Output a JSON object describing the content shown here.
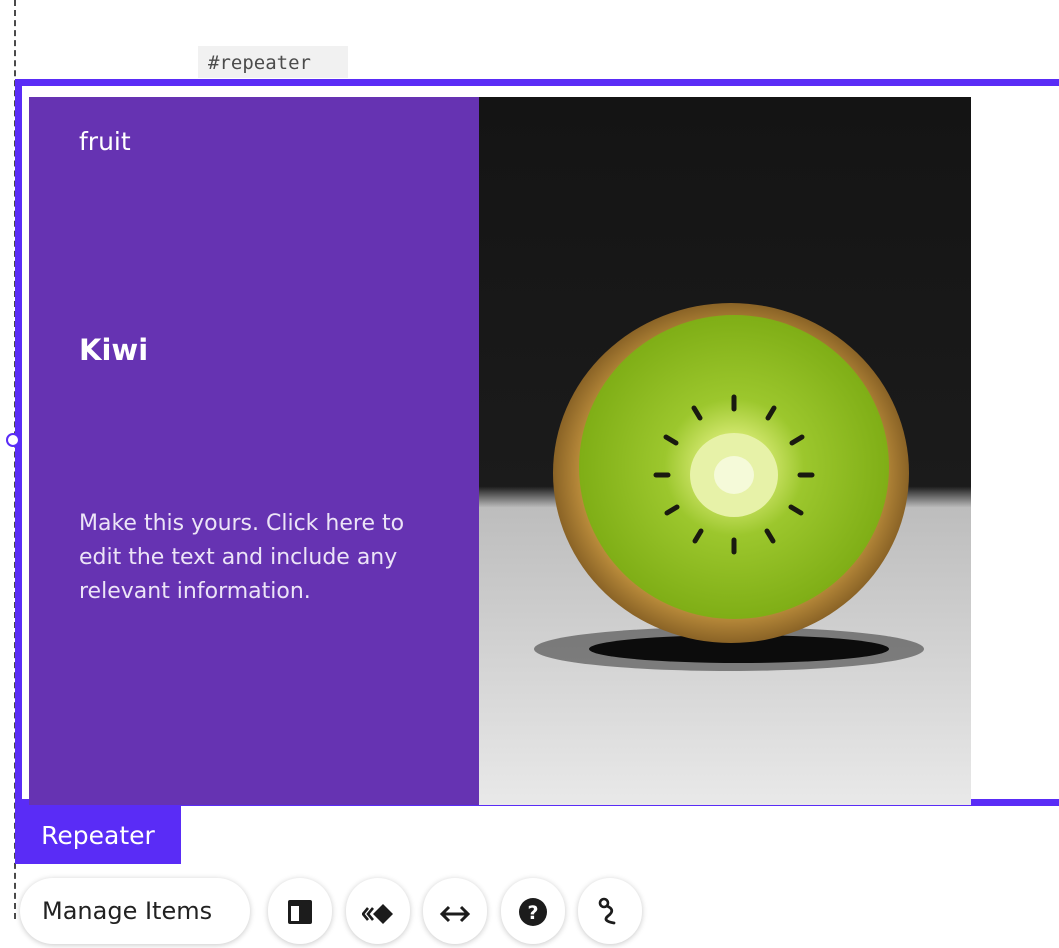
{
  "element_id_tag": "#repeater",
  "repeater_item": {
    "category": "fruit",
    "title": "Kiwi",
    "description": "Make this yours. Click here to edit the text and include any relevant information."
  },
  "selection_label": "Repeater",
  "toolbar": {
    "manage_items_label": "Manage Items",
    "icons": [
      "layout-icon",
      "animation-icon",
      "stretch-icon",
      "help-icon",
      "connect-icon"
    ]
  },
  "colors": {
    "selection_accent": "#5a2cf6",
    "item_background": "#6633b2",
    "text": "#ffffff"
  }
}
